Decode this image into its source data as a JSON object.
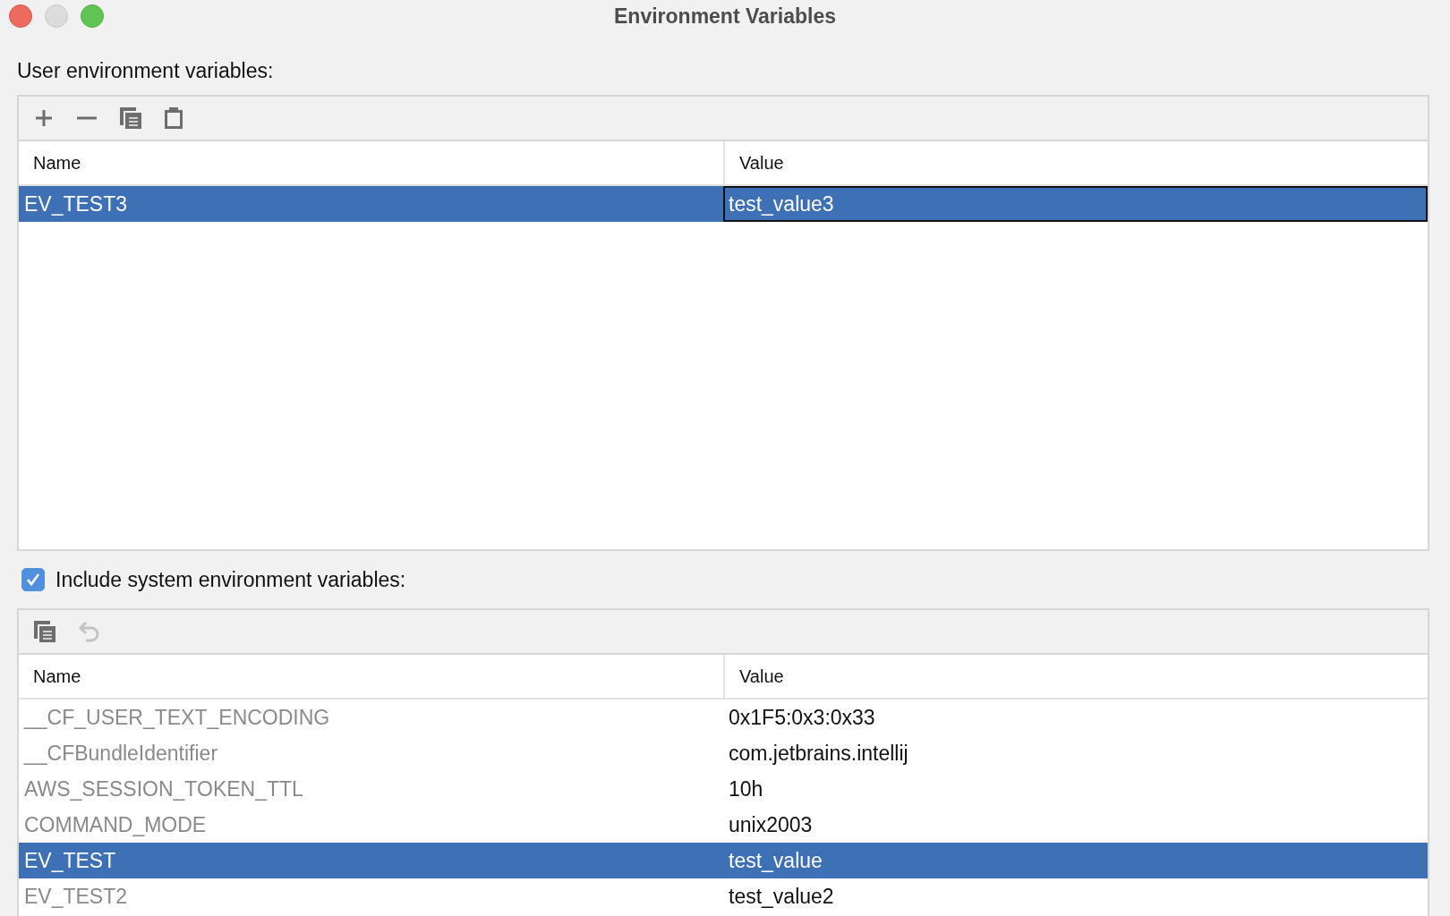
{
  "window": {
    "title": "Environment Variables"
  },
  "user_section": {
    "label": "User environment variables:",
    "toolbar": [
      {
        "kind": "add",
        "disabled": false
      },
      {
        "kind": "remove",
        "disabled": false
      },
      {
        "kind": "copy",
        "disabled": false
      },
      {
        "kind": "paste",
        "disabled": false
      }
    ],
    "columns": [
      "Name",
      "Value"
    ],
    "rows": [
      {
        "name": "EV_TEST3",
        "value": "test_value3",
        "selected": true,
        "focused": true
      }
    ]
  },
  "system_section": {
    "label": "Include system environment variables:",
    "checked": true,
    "toolbar": [
      {
        "kind": "copy",
        "disabled": false
      },
      {
        "kind": "undo",
        "disabled": true
      }
    ],
    "columns": [
      "Name",
      "Value"
    ],
    "rows": [
      {
        "name": "__CF_USER_TEXT_ENCODING",
        "value": "0x1F5:0x3:0x33",
        "selected": false
      },
      {
        "name": "__CFBundleIdentifier",
        "value": "com.jetbrains.intellij",
        "selected": false
      },
      {
        "name": "AWS_SESSION_TOKEN_TTL",
        "value": "10h",
        "selected": false
      },
      {
        "name": "COMMAND_MODE",
        "value": "unix2003",
        "selected": false
      },
      {
        "name": "EV_TEST",
        "value": "test_value",
        "selected": true
      },
      {
        "name": "EV_TEST2",
        "value": "test_value2",
        "selected": false
      }
    ]
  }
}
